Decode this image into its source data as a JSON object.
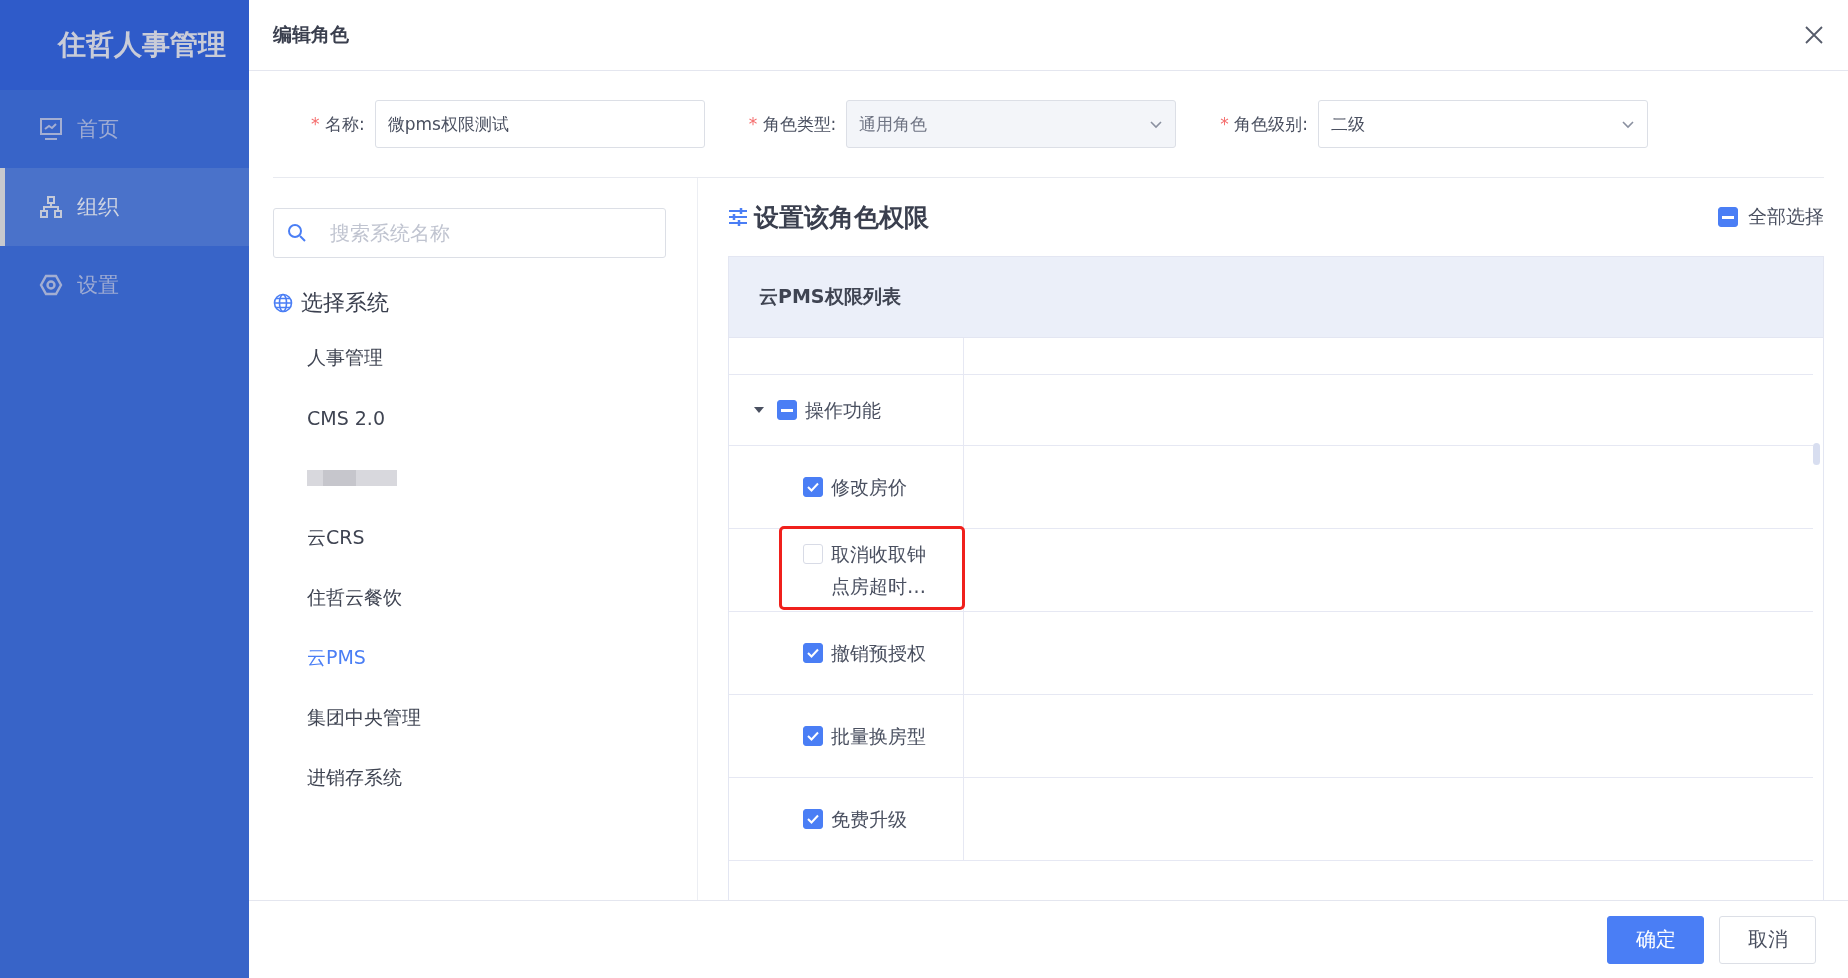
{
  "sidebar": {
    "title": "住哲人事管理",
    "items": [
      {
        "label": "首页",
        "selected": false
      },
      {
        "label": "组织",
        "selected": true
      },
      {
        "label": "设置",
        "selected": false
      }
    ]
  },
  "dialog": {
    "title": "编辑角色",
    "fields": [
      {
        "mark": "*",
        "label": "名称:",
        "kind": "input",
        "value": "微pms权限测试",
        "disabled": false
      },
      {
        "mark": "*",
        "label": "角色类型:",
        "kind": "select",
        "value": "通用角色",
        "disabled": true
      },
      {
        "mark": "*",
        "label": "角色级别:",
        "kind": "select",
        "value": "二级",
        "disabled": false
      }
    ],
    "search": {
      "placeholder": "搜索系统名称"
    },
    "systems_heading": "选择系统",
    "systems": [
      {
        "kind": "text",
        "label": "人事管理",
        "selected": false
      },
      {
        "kind": "text",
        "label": "CMS 2.0",
        "selected": false
      },
      {
        "kind": "redacted",
        "selected": false
      },
      {
        "kind": "text",
        "label": "云CRS",
        "selected": false
      },
      {
        "kind": "text",
        "label": "住哲云餐饮",
        "selected": false
      },
      {
        "kind": "text",
        "label": "云PMS",
        "selected": true
      },
      {
        "kind": "text",
        "label": "集团中央管理",
        "selected": false
      },
      {
        "kind": "text",
        "label": "进销存系统",
        "selected": false
      }
    ],
    "permissions_title": "设置该角色权限",
    "select_all": {
      "label": "全部选择",
      "checked": true,
      "indeterminate": true
    },
    "table": {
      "title": "云PMS权限列表",
      "groups": [
        {
          "label": "操作功能",
          "checked": true,
          "indeterminate": true,
          "expanded": true,
          "children": [
            {
              "label": "修改房价",
              "checked": true,
              "highlighted": false
            },
            {
              "label": "取消收取钟点房超时…",
              "checked": false,
              "highlighted": true
            },
            {
              "label": "撤销预授权",
              "checked": true,
              "highlighted": false
            },
            {
              "label": "批量换房型",
              "checked": true,
              "highlighted": false
            },
            {
              "label": "免费升级",
              "checked": true,
              "highlighted": false
            }
          ]
        }
      ]
    },
    "buttons": [
      {
        "label": "确定",
        "kind": "primary"
      },
      {
        "label": "取消",
        "kind": "default"
      }
    ]
  }
}
